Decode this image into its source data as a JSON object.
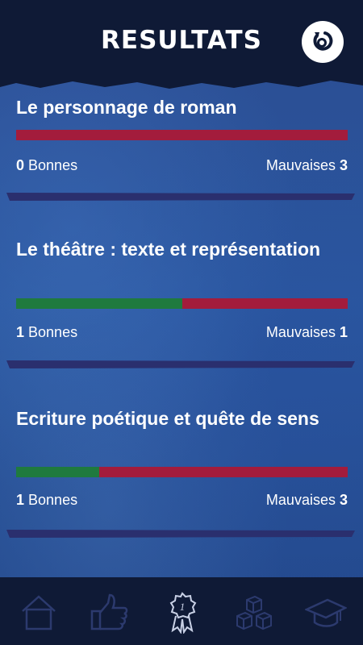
{
  "header": {
    "title": "RESULTATS",
    "restart_icon": "restart-icon"
  },
  "colors": {
    "good": "#1f7a3e",
    "bad": "#a31c3c",
    "header_bg": "#0f1a36",
    "panel_bg": "#2a579f"
  },
  "results": [
    {
      "title": "Le personnage de roman",
      "good": "0",
      "good_label": "Bonnes",
      "bad_label": "Mauvaises",
      "bad": "3"
    },
    {
      "title": "Le théâtre : texte et représentation",
      "good": "1",
      "good_label": "Bonnes",
      "bad_label": "Mauvaises",
      "bad": "1"
    },
    {
      "title": "Ecriture poétique et quête de sens",
      "good": "1",
      "good_label": "Bonnes",
      "bad_label": "Mauvaises",
      "bad": "3"
    }
  ],
  "tabs": [
    {
      "icon": "home-icon"
    },
    {
      "icon": "thumbs-up-icon"
    },
    {
      "icon": "ranking-badge-icon",
      "label": "1"
    },
    {
      "icon": "blocks-icon"
    },
    {
      "icon": "graduation-cap-icon"
    }
  ]
}
